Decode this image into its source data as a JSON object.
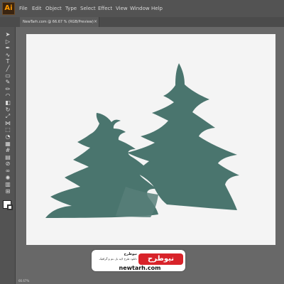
{
  "app": {
    "logo": "Ai",
    "accent_color": "#ff9a00"
  },
  "menu": [
    "File",
    "Edit",
    "Object",
    "Type",
    "Select",
    "Effect",
    "View",
    "Window",
    "Help"
  ],
  "document_tab": {
    "title": "NewTarh.com @ 66.67 % (RGB/Preview)",
    "close": "×"
  },
  "tools": [
    {
      "name": "selection-tool-icon",
      "glyph": "➤"
    },
    {
      "name": "direct-selection-tool-icon",
      "glyph": "▷"
    },
    {
      "name": "pen-tool-icon",
      "glyph": "✒"
    },
    {
      "name": "curvature-tool-icon",
      "glyph": "∿"
    },
    {
      "name": "type-tool-icon",
      "glyph": "T"
    },
    {
      "name": "line-tool-icon",
      "glyph": "╱"
    },
    {
      "name": "rectangle-tool-icon",
      "glyph": "▭"
    },
    {
      "name": "paintbrush-tool-icon",
      "glyph": "✎"
    },
    {
      "name": "pencil-tool-icon",
      "glyph": "✏"
    },
    {
      "name": "shaper-tool-icon",
      "glyph": "◠"
    },
    {
      "name": "eraser-tool-icon",
      "glyph": "◧"
    },
    {
      "name": "rotate-tool-icon",
      "glyph": "↻"
    },
    {
      "name": "scale-tool-icon",
      "glyph": "⤢"
    },
    {
      "name": "width-tool-icon",
      "glyph": "⋈"
    },
    {
      "name": "free-transform-tool-icon",
      "glyph": "⬚"
    },
    {
      "name": "shape-builder-tool-icon",
      "glyph": "◔"
    },
    {
      "name": "perspective-grid-tool-icon",
      "glyph": "▦"
    },
    {
      "name": "mesh-tool-icon",
      "glyph": "#"
    },
    {
      "name": "gradient-tool-icon",
      "glyph": "▤"
    },
    {
      "name": "eyedropper-tool-icon",
      "glyph": "⊘"
    },
    {
      "name": "blend-tool-icon",
      "glyph": "∞"
    },
    {
      "name": "symbol-sprayer-tool-icon",
      "glyph": "✺"
    },
    {
      "name": "column-graph-tool-icon",
      "glyph": "▥"
    },
    {
      "name": "artboard-tool-icon",
      "glyph": "⊞"
    }
  ],
  "colors": {
    "fill": "#ffffff",
    "stroke": "#ffffff",
    "tree": "#4a756e",
    "tree_shadow": "#577f79"
  },
  "watermark": {
    "logo_text": "نیوطرح",
    "title": "نیوطرح",
    "subtitle": "دانلود طرح لایه باز ،تم و گرافیک",
    "url": "newtarh.com"
  },
  "status": {
    "zoom": "66.67%"
  }
}
